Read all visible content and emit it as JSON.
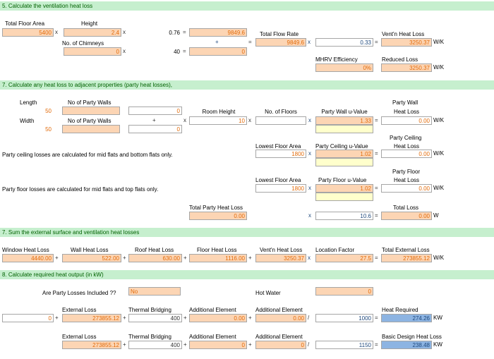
{
  "sec5": {
    "title": "5. Calculate the ventilation heat loss",
    "total_floor_area": "Total Floor Area",
    "height": "Height",
    "tfa_val": "5400",
    "x1": "x",
    "height_val": "2.4",
    "x2": "x",
    "k1": "0.76",
    "eq1": "=",
    "v1": "9849.6",
    "total_flow_rate": "Total Flow Rate",
    "vent_heat_loss": "Vent'n Heat Loss",
    "chimneys": "No. of Chimneys",
    "chim_val": "0",
    "x3": "x",
    "k2": "40",
    "eq2": "=",
    "plus": "+",
    "v2": "0",
    "eq3": "=",
    "tfr_val": "9849.6",
    "x4": "x",
    "k3": "0.33",
    "eq4": "=",
    "vhl_val": "3250.37",
    "wk1": "W/K",
    "mhrv": "MHRV Efficiency",
    "mhrv_val": "0%",
    "reduced_loss": "Reduced Loss",
    "rl_val": "3250.37",
    "wk2": "W/K"
  },
  "sec7": {
    "title": "7. Calculate any heat loss to adjacent properties (party heat losses),",
    "length": "Length",
    "party_walls1": "No of Party Walls",
    "len_val": "50",
    "pw1_blank": "",
    "z1": "0",
    "room_height": "Room Height",
    "floors": "No. of Floors",
    "pw_u": "Party Wall u-Value",
    "party_wall": "Party Wall",
    "heat_loss": "Heat Loss",
    "width": "Width",
    "party_walls2": "No of Party Walls",
    "plus": "+",
    "x5": "x",
    "rh_val": "10",
    "x6": "x",
    "x7": "x",
    "pwu_val": "1.33",
    "eq5": "=",
    "pwhl_val": "0.00",
    "wk3": "W/K",
    "wid_val": "50",
    "pw2_blank": "",
    "z2": "0",
    "party_ceiling": "Party Ceiling",
    "heat_loss2": "Heat Loss",
    "lowest_floor_area": "Lowest Floor Area",
    "pc_u": "Party Ceiling u-Value",
    "lfa1": "1800",
    "x8": "x",
    "pcu_val": "1.02",
    "eq6": "=",
    "pchl_val": "0.00",
    "wk4": "W/K",
    "ceiling_note": "Party ceiling losses are calculated for mid flats and bottom flats only.",
    "party_floor": "Party Floor",
    "heat_loss3": "Heat Loss",
    "lowest_floor_area2": "Lowest Floor Area",
    "pf_u": "Party Floor u-Value",
    "lfa2": "1800",
    "x9": "x",
    "pfu_val": "1.02",
    "eq7": "=",
    "pfhl_val": "0.00",
    "wk5": "W/K",
    "floor_note": "Party floor losses are calculated for mid flats and top flats only.",
    "total_party": "Total Party Heat Loss",
    "tp_val": "0.00",
    "x10": "x",
    "k4": "10.6",
    "eq8": "=",
    "total_loss": "Total Loss",
    "tl_val": "0.00",
    "w1": "W"
  },
  "sec7b": {
    "title": "7. Sum the external surface and ventilation heat losses",
    "window": "Window Heat Loss",
    "wall": "Wall Heat Loss",
    "roof": "Roof Heat Loss",
    "floor": "Floor Heat Loss",
    "vent": "Vent'n Heat Loss",
    "location": "Location Factor",
    "total_ext": "Total External Loss",
    "win_val": "4440.00",
    "p1": "+",
    "wall_val": "522.00",
    "p2": "+",
    "roof_val": "630.00",
    "p3": "+",
    "floor_val": "1116.00",
    "p4": "+",
    "vent_val": "3250.37",
    "x11": "x",
    "loc_val": "27.5",
    "eq9": "=",
    "tel_val": "273855.12",
    "wk6": "W/K"
  },
  "sec8": {
    "title": "8. Calculate required heat output (in kW)",
    "party_included": "Are Party Losses Included ??",
    "pi_val": "No",
    "hot_water": "Hot Water",
    "hw_val": "0",
    "ext_loss": "External Loss",
    "tb": "Thermal Bridging",
    "add_el": "Additional Element",
    "add_el2": "Additional Element",
    "heat_req": "Heat Required",
    "r1_a": "0",
    "r1_p1": "+",
    "r1_ext": "273855.12",
    "r1_p2": "+",
    "r1_tb": "400",
    "r1_p3": "+",
    "r1_ae": "0.00",
    "r1_p4": "+",
    "r1_ae2": "0.00",
    "r1_div": "/",
    "r1_k": "1000",
    "r1_eq": "=",
    "r1_hr": "274.26",
    "kw1": "KW",
    "ext_loss2": "External Loss",
    "tb2": "Thermal Bridging",
    "add_el3": "Additional Element",
    "add_el4": "Additional Element",
    "basic_design": "Basic Design Heat Loss",
    "r2_ext": "273855.12",
    "r2_p1": "+",
    "r2_tb": "400",
    "r2_p2": "+",
    "r2_ae": "0",
    "r2_p3": "+",
    "r2_ae2": "0",
    "r2_div": "/",
    "r2_k": "1150",
    "r2_eq": "=",
    "r2_bd": "238.48",
    "kw2": "KW"
  }
}
